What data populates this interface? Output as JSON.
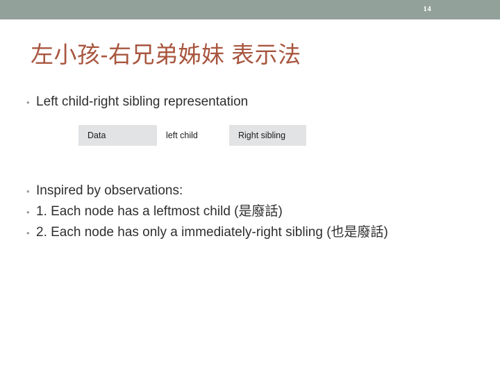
{
  "header": {
    "band_color": "#92a199",
    "page_number": "14"
  },
  "slide": {
    "title": "左小孩-右兄弟姊妹 表示法",
    "title_color": "#a8563f",
    "bullet_glyph": "•",
    "bullets": [
      {
        "text": "Left child-right sibling representation"
      },
      {
        "text": "Inspired by observations:"
      },
      {
        "text": "1. Each node has a leftmost child (是廢話)"
      },
      {
        "text": "2. Each node has only a immediately-right sibling (也是廢話)"
      }
    ]
  },
  "table": {
    "cells": [
      {
        "label": "Data",
        "background": "#e1e3e5"
      },
      {
        "label": "left child",
        "background": "#ffffff"
      },
      {
        "label": "Right sibling",
        "background": "#e1e3e5"
      }
    ]
  }
}
